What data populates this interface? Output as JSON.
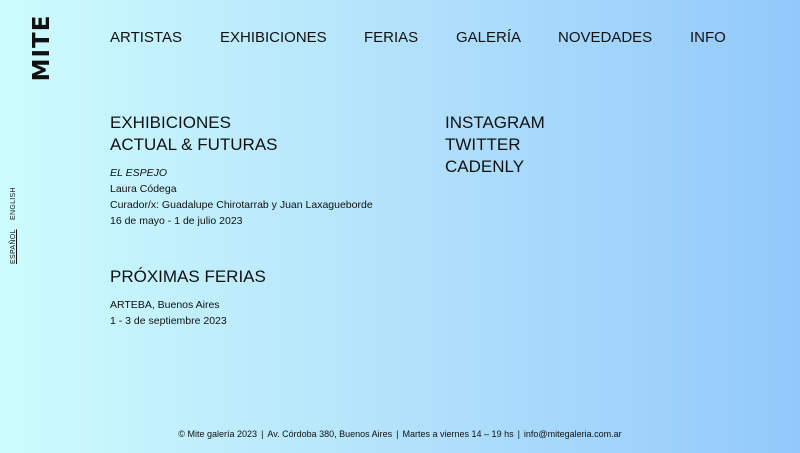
{
  "logo": "MITE",
  "nav": [
    "ARTISTAS",
    "EXHIBICIONES",
    "FERIAS",
    "GALERÍA",
    "NOVEDADES",
    "INFO"
  ],
  "languages": {
    "english": "ENGLISH",
    "espanol": "ESPAÑOL",
    "active": "ESPAÑOL"
  },
  "exhibitions": {
    "heading_line1": "EXHIBICIONES",
    "heading_line2": "ACTUAL & FUTURAS",
    "title": "EL ESPEJO",
    "artist": "Laura Códega",
    "curators": "Curador/x: Guadalupe Chirotarrab y Juan Laxagueborde",
    "dates": "16 de mayo - 1 de julio 2023"
  },
  "fairs": {
    "heading": "PRÓXIMAS FERIAS",
    "name": "ARTEBA, Buenos Aires",
    "dates": "1 - 3 de septiembre 2023"
  },
  "social": [
    "INSTAGRAM",
    "TWITTER",
    "CADENLY"
  ],
  "footer": {
    "copyright": "© Mite galería 2023",
    "address": "Av. Córdoba 380, Buenos Aires",
    "hours": "Martes a viernes 14 – 19 hs",
    "email": "info@mitegaleria.com.ar"
  }
}
